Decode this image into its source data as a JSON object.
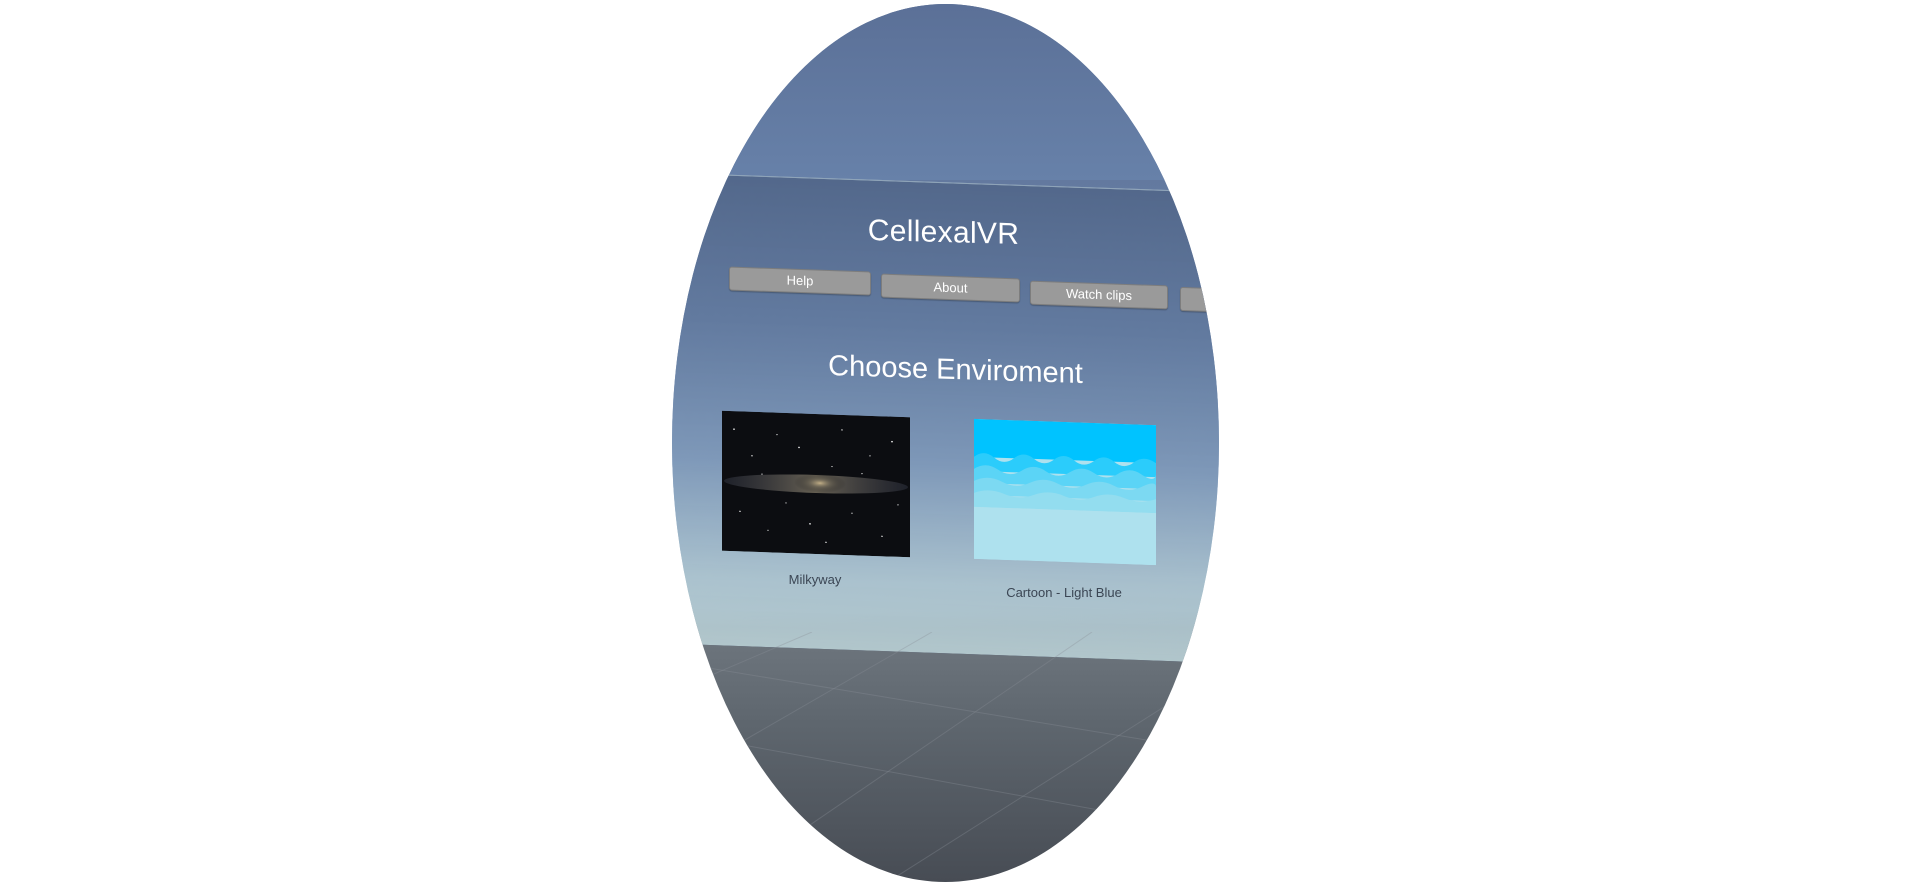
{
  "app": {
    "title": "CellexalVR"
  },
  "nav": {
    "items": [
      {
        "label": ""
      },
      {
        "label": "Help"
      },
      {
        "label": "About"
      },
      {
        "label": "Watch clips"
      },
      {
        "label": ""
      }
    ]
  },
  "environments": {
    "heading": "Choose Enviroment",
    "options": [
      {
        "label": "Milkyway",
        "icon": "milkyway-thumbnail"
      },
      {
        "label": "Cartoon - Light Blue",
        "icon": "cartoon-light-blue-thumbnail"
      }
    ]
  },
  "colors": {
    "sky": "#6780a8",
    "button": "#9a9a9a",
    "floor": "#5e666e",
    "cartoon_sky": "#00c3ff"
  }
}
